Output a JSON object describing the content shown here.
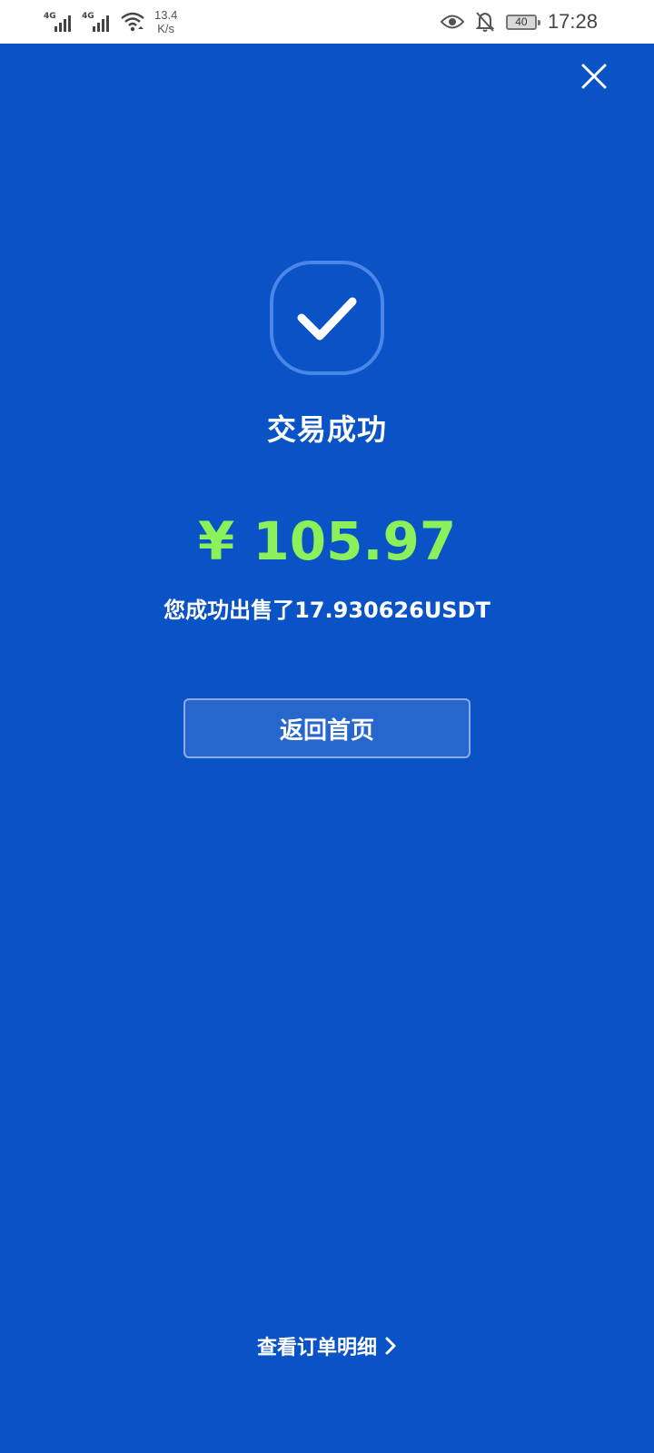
{
  "status_bar": {
    "signal1_tag": "4G",
    "signal2_tag": "4G",
    "net_speed_value": "13.4",
    "net_speed_unit": "K/s",
    "battery_level": "40",
    "time": "17:28"
  },
  "result": {
    "title": "交易成功",
    "amount": "¥ 105.97",
    "description": "您成功出售了17.930626USDT"
  },
  "actions": {
    "home_label": "返回首页",
    "details_label": "查看订单明细"
  },
  "colors": {
    "background": "#0a53c6",
    "amount": "#8cf05a",
    "text": "#ffffff"
  },
  "icons": {
    "close": "close-icon",
    "success": "checkmark-icon",
    "details": "chevron-right-icon"
  }
}
